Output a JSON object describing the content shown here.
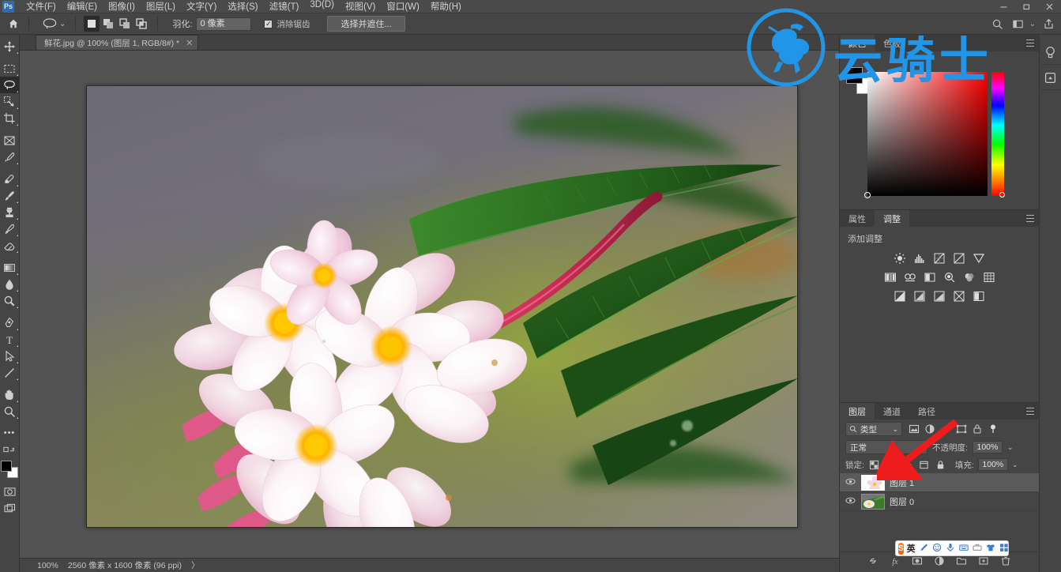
{
  "app": {
    "logo_icon": "photoshop-logo",
    "menus": [
      {
        "label": "文件(F)"
      },
      {
        "label": "编辑(E)"
      },
      {
        "label": "图像(I)"
      },
      {
        "label": "图层(L)"
      },
      {
        "label": "文字(Y)"
      },
      {
        "label": "选择(S)"
      },
      {
        "label": "滤镜(T)"
      },
      {
        "label": "3D(D)"
      },
      {
        "label": "视图(V)"
      },
      {
        "label": "窗口(W)"
      },
      {
        "label": "帮助(H)"
      }
    ],
    "window_controls": [
      {
        "name": "minimize",
        "glyph": "—"
      },
      {
        "name": "maximize",
        "glyph": "❐"
      },
      {
        "name": "close",
        "glyph": "✕"
      }
    ]
  },
  "options_bar": {
    "home_icon": "home-icon",
    "tool_icon": "lasso-tool-icon",
    "tool_dropdown_glyph": "⌄",
    "selection_modes": [
      {
        "name": "new-selection",
        "glyph": "◼",
        "active": true
      },
      {
        "name": "add-to-selection",
        "glyph": "❐",
        "active": false
      },
      {
        "name": "subtract-from-selection",
        "glyph": "❏",
        "active": false
      },
      {
        "name": "intersect-selection",
        "glyph": "❒",
        "active": false
      }
    ],
    "feather_label": "羽化:",
    "feather_value": "0 像素",
    "antialias_label": "消除锯齿",
    "antialias_checked": true,
    "select_and_mask_label": "选择并遮住...",
    "search_icon": "search-icon",
    "workspace_icon": "workspace-icon",
    "workspace_chevron": "⌄",
    "share_icon": "share-icon"
  },
  "toolbar": {
    "tools": [
      {
        "name": "move-tool",
        "glyph": "✥",
        "active": false,
        "corner": true
      },
      {
        "name": "rectangular-marquee-tool",
        "glyph": "▭",
        "active": false,
        "corner": true
      },
      {
        "name": "lasso-tool",
        "glyph": "◯",
        "active": true,
        "corner": true
      },
      {
        "name": "quick-selection-tool",
        "glyph": "▨",
        "active": false,
        "corner": true
      },
      {
        "name": "crop-tool",
        "glyph": "⌗",
        "active": false,
        "corner": true
      },
      {
        "name": "frame-tool",
        "glyph": "⊠",
        "active": false,
        "corner": false
      },
      {
        "name": "eyedropper-tool",
        "glyph": "✑",
        "active": false,
        "corner": true
      },
      {
        "name": "healing-brush-tool",
        "glyph": "⌫",
        "active": false,
        "corner": true
      },
      {
        "name": "brush-tool",
        "glyph": "✎",
        "active": false,
        "corner": true
      },
      {
        "name": "clone-stamp-tool",
        "glyph": "⎈",
        "active": false,
        "corner": true
      },
      {
        "name": "history-brush-tool",
        "glyph": "✦",
        "active": false,
        "corner": true
      },
      {
        "name": "eraser-tool",
        "glyph": "◨",
        "active": false,
        "corner": true
      },
      {
        "name": "gradient-tool",
        "glyph": "▤",
        "active": false,
        "corner": true
      },
      {
        "name": "blur-tool",
        "glyph": "💧",
        "active": false,
        "corner": true
      },
      {
        "name": "dodge-tool",
        "glyph": "◔",
        "active": false,
        "corner": true
      },
      {
        "name": "pen-tool",
        "glyph": "✒",
        "active": false,
        "corner": true
      },
      {
        "name": "type-tool",
        "glyph": "T",
        "active": false,
        "corner": true
      },
      {
        "name": "path-selection-tool",
        "glyph": "➤",
        "active": false,
        "corner": true
      },
      {
        "name": "rectangle-shape-tool",
        "glyph": "╱",
        "active": false,
        "corner": true
      },
      {
        "name": "hand-tool",
        "glyph": "✋",
        "active": false,
        "corner": true
      },
      {
        "name": "zoom-tool",
        "glyph": "⌕",
        "active": false,
        "corner": true
      }
    ],
    "more_tools_glyph": "•••",
    "edit_toolbar_icon": "edit-toolbar-icon",
    "foreground_color": "#000000",
    "background_color": "#ffffff",
    "quick_mask_icon": "quick-mask-icon",
    "screen_mode_icon": "screen-mode-icon"
  },
  "document": {
    "tab_title": "鲜花.jpg @ 100% (图层 1, RGB/8#) *",
    "close_glyph": "✕"
  },
  "status_bar": {
    "zoom": "100%",
    "dimensions": "2560 像素 x 1600 像素 (96 ppi)",
    "expand_glyph": "〉"
  },
  "right_rail": [
    {
      "name": "rail-learn-icon",
      "glyph": "♀"
    },
    {
      "name": "rail-libraries-icon",
      "glyph": "▣"
    }
  ],
  "color_panel": {
    "tabs": [
      {
        "label": "颜色",
        "active": true
      },
      {
        "label": "色板",
        "active": false
      }
    ],
    "menu_icon": "panel-menu-icon",
    "foreground": "#000000",
    "background": "#ffffff",
    "selected_hue": "#ff0000"
  },
  "adjustments_panel": {
    "tabs": [
      {
        "label": "属性",
        "active": false
      },
      {
        "label": "调整",
        "active": true
      }
    ],
    "menu_icon": "panel-menu-icon",
    "title": "添加调整",
    "rows": [
      [
        {
          "name": "brightness-contrast-icon",
          "glyph": "☀"
        },
        {
          "name": "levels-icon",
          "glyph": "▥"
        },
        {
          "name": "curves-icon",
          "glyph": "▨"
        },
        {
          "name": "exposure-icon",
          "glyph": "◺"
        },
        {
          "name": "vibrance-icon",
          "glyph": "▽"
        }
      ],
      [
        {
          "name": "hue-saturation-icon",
          "glyph": "▦"
        },
        {
          "name": "color-balance-icon",
          "glyph": "⚖"
        },
        {
          "name": "black-white-icon",
          "glyph": "◧"
        },
        {
          "name": "photo-filter-icon",
          "glyph": "◍"
        },
        {
          "name": "channel-mixer-icon",
          "glyph": "◕"
        },
        {
          "name": "color-lookup-icon",
          "glyph": "▦"
        }
      ],
      [
        {
          "name": "invert-icon",
          "glyph": "◪"
        },
        {
          "name": "posterize-icon",
          "glyph": "◩"
        },
        {
          "name": "threshold-icon",
          "glyph": "◨"
        },
        {
          "name": "gradient-map-icon",
          "glyph": "◣"
        },
        {
          "name": "selective-color-icon",
          "glyph": "◫"
        }
      ]
    ]
  },
  "layers_panel": {
    "tabs": [
      {
        "label": "图层",
        "active": true
      },
      {
        "label": "通道",
        "active": false
      },
      {
        "label": "路径",
        "active": false
      }
    ],
    "menu_icon": "panel-menu-icon",
    "filter": {
      "search_icon": "search-icon",
      "type_label": "类型",
      "chevron": "⌄",
      "icons": [
        {
          "name": "filter-pixel-icon",
          "glyph": "▣"
        },
        {
          "name": "filter-adjustment-icon",
          "glyph": "◑"
        },
        {
          "name": "filter-type-icon",
          "glyph": "T"
        },
        {
          "name": "filter-shape-icon",
          "glyph": "⬚"
        },
        {
          "name": "filter-smart-object-icon",
          "glyph": "🔒"
        },
        {
          "name": "filter-toggle-icon",
          "glyph": "◉"
        }
      ]
    },
    "blend_mode": "正常",
    "opacity_label": "不透明度:",
    "opacity_value": "100%",
    "opacity_chevron": "⌄",
    "lock_label": "锁定:",
    "lock_icons": [
      {
        "name": "lock-transparent-pixels-icon",
        "glyph": "▩"
      },
      {
        "name": "lock-image-pixels-icon",
        "glyph": "✎"
      },
      {
        "name": "lock-position-icon",
        "glyph": "✛"
      },
      {
        "name": "lock-artboard-icon",
        "glyph": "⛶"
      },
      {
        "name": "lock-all-icon",
        "glyph": "🔒"
      }
    ],
    "fill_label": "填充:",
    "fill_value": "100%",
    "fill_chevron": "⌄",
    "layers": [
      {
        "name": "图层 1",
        "visible": true,
        "selected": true,
        "thumb": "flower-cutout"
      },
      {
        "name": "图层 0",
        "visible": true,
        "selected": false,
        "thumb": "full-photo"
      }
    ],
    "bottom_buttons": [
      {
        "name": "link-layers-button",
        "glyph": "⛓"
      },
      {
        "name": "layer-style-button",
        "glyph": "fx"
      },
      {
        "name": "layer-mask-button",
        "glyph": "▣"
      },
      {
        "name": "new-fill-adjustment-button",
        "glyph": "◐"
      },
      {
        "name": "new-group-button",
        "glyph": "▰"
      },
      {
        "name": "new-layer-button",
        "glyph": "⊞"
      },
      {
        "name": "delete-layer-button",
        "glyph": "🗑"
      }
    ]
  },
  "watermark": {
    "text": "云骑士",
    "color": "#2196e8",
    "logo_icon": "horseman-circle-logo"
  },
  "ime_bar": {
    "logo_text": "S",
    "mode_label": "英",
    "icons": [
      {
        "name": "ime-pen-icon",
        "glyph": "✎"
      },
      {
        "name": "ime-emoji-icon",
        "glyph": "☺"
      },
      {
        "name": "ime-voice-icon",
        "glyph": "🎤"
      },
      {
        "name": "ime-keyboard-icon",
        "glyph": "⌨"
      },
      {
        "name": "ime-toolbox-icon",
        "glyph": "▤"
      },
      {
        "name": "ime-skin-icon",
        "glyph": "👕"
      },
      {
        "name": "ime-menu-icon",
        "glyph": "▦"
      }
    ]
  },
  "annotation": {
    "arrow_color": "#ee1c1c",
    "arrow_name": "red-pointer-arrow"
  }
}
